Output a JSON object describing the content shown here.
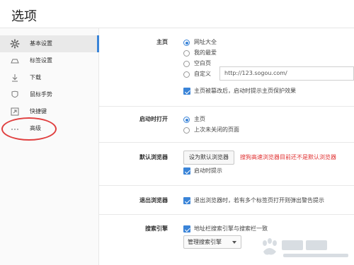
{
  "window": {
    "title": "选项"
  },
  "sidebar": {
    "items": [
      {
        "label": "基本设置",
        "icon": "gear-icon",
        "active": true
      },
      {
        "label": "标签设置",
        "icon": "tab-icon",
        "active": false
      },
      {
        "label": "下载",
        "icon": "download-icon",
        "active": false
      },
      {
        "label": "鼠标手势",
        "icon": "mouse-icon",
        "active": false
      },
      {
        "label": "快捷键",
        "icon": "shortcut-icon",
        "active": false
      },
      {
        "label": "高级",
        "icon": "more-dots-icon",
        "active": false
      }
    ]
  },
  "homepage": {
    "label": "主页",
    "options": [
      "网址大全",
      "我的最爱",
      "空白页",
      "自定义"
    ],
    "selected": "网址大全",
    "custom_url": "http://123.sogou.com/",
    "protect_label": "主页被篡改后，启动时提示主页保护效果",
    "protect_checked": true
  },
  "startup": {
    "label": "启动时打开",
    "options": [
      "主页",
      "上次未关闭的页面"
    ],
    "selected": "主页"
  },
  "default_browser": {
    "label": "默认浏览器",
    "button_label": "设为默认浏览器",
    "warning": "搜狗高速浏览器目前还不是默认浏览器",
    "startup_prompt_label": "启动时提示",
    "startup_prompt_checked": true
  },
  "exit_browser": {
    "label": "退出浏览器",
    "prompt_label": "退出浏览器时，若有多个标签页打开则弹出警告提示",
    "prompt_checked": true
  },
  "search_engine": {
    "label": "搜索引擎",
    "unify_label": "地址栏搜索引擎与搜索栏一致",
    "unify_checked": true,
    "manage_label": "管理搜索引擎"
  },
  "colors": {
    "accent": "#3a84d8",
    "warning": "#e03030",
    "annotation": "#e04040"
  }
}
